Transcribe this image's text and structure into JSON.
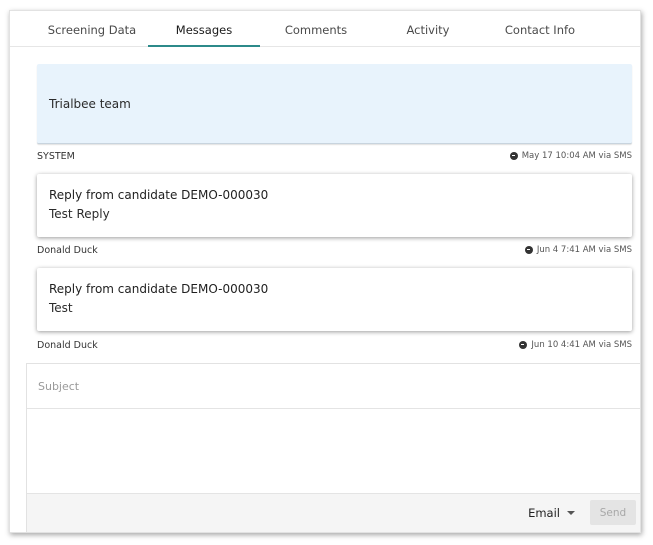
{
  "tabs": [
    {
      "label": "Screening Data",
      "active": false
    },
    {
      "label": "Messages",
      "active": true
    },
    {
      "label": "Comments",
      "active": false
    },
    {
      "label": "Activity",
      "active": false
    },
    {
      "label": "Contact Info",
      "active": false
    }
  ],
  "messages": [
    {
      "title": "Trialbee team",
      "body": "",
      "author": "SYSTEM",
      "timestamp": "May 17 10:04 AM via SMS"
    },
    {
      "title": "Reply from candidate DEMO-000030",
      "body": "Test Reply",
      "author": "Donald Duck",
      "timestamp": "Jun 4 7:41 AM via SMS"
    },
    {
      "title": "Reply from candidate DEMO-000030",
      "body": "Test",
      "author": "Donald Duck",
      "timestamp": "Jun 10 4:41 AM via SMS"
    }
  ],
  "compose": {
    "subject_placeholder": "Subject",
    "subject_value": "",
    "body_value": "",
    "channel": "Email",
    "send_label": "Send"
  },
  "colors": {
    "active_tab_underline": "#2c8a8a",
    "system_message_bg": "#e8f3fc"
  },
  "icons": {
    "timestamp_icon": "incoming-message-icon",
    "channel_caret": "caret-down-icon"
  }
}
